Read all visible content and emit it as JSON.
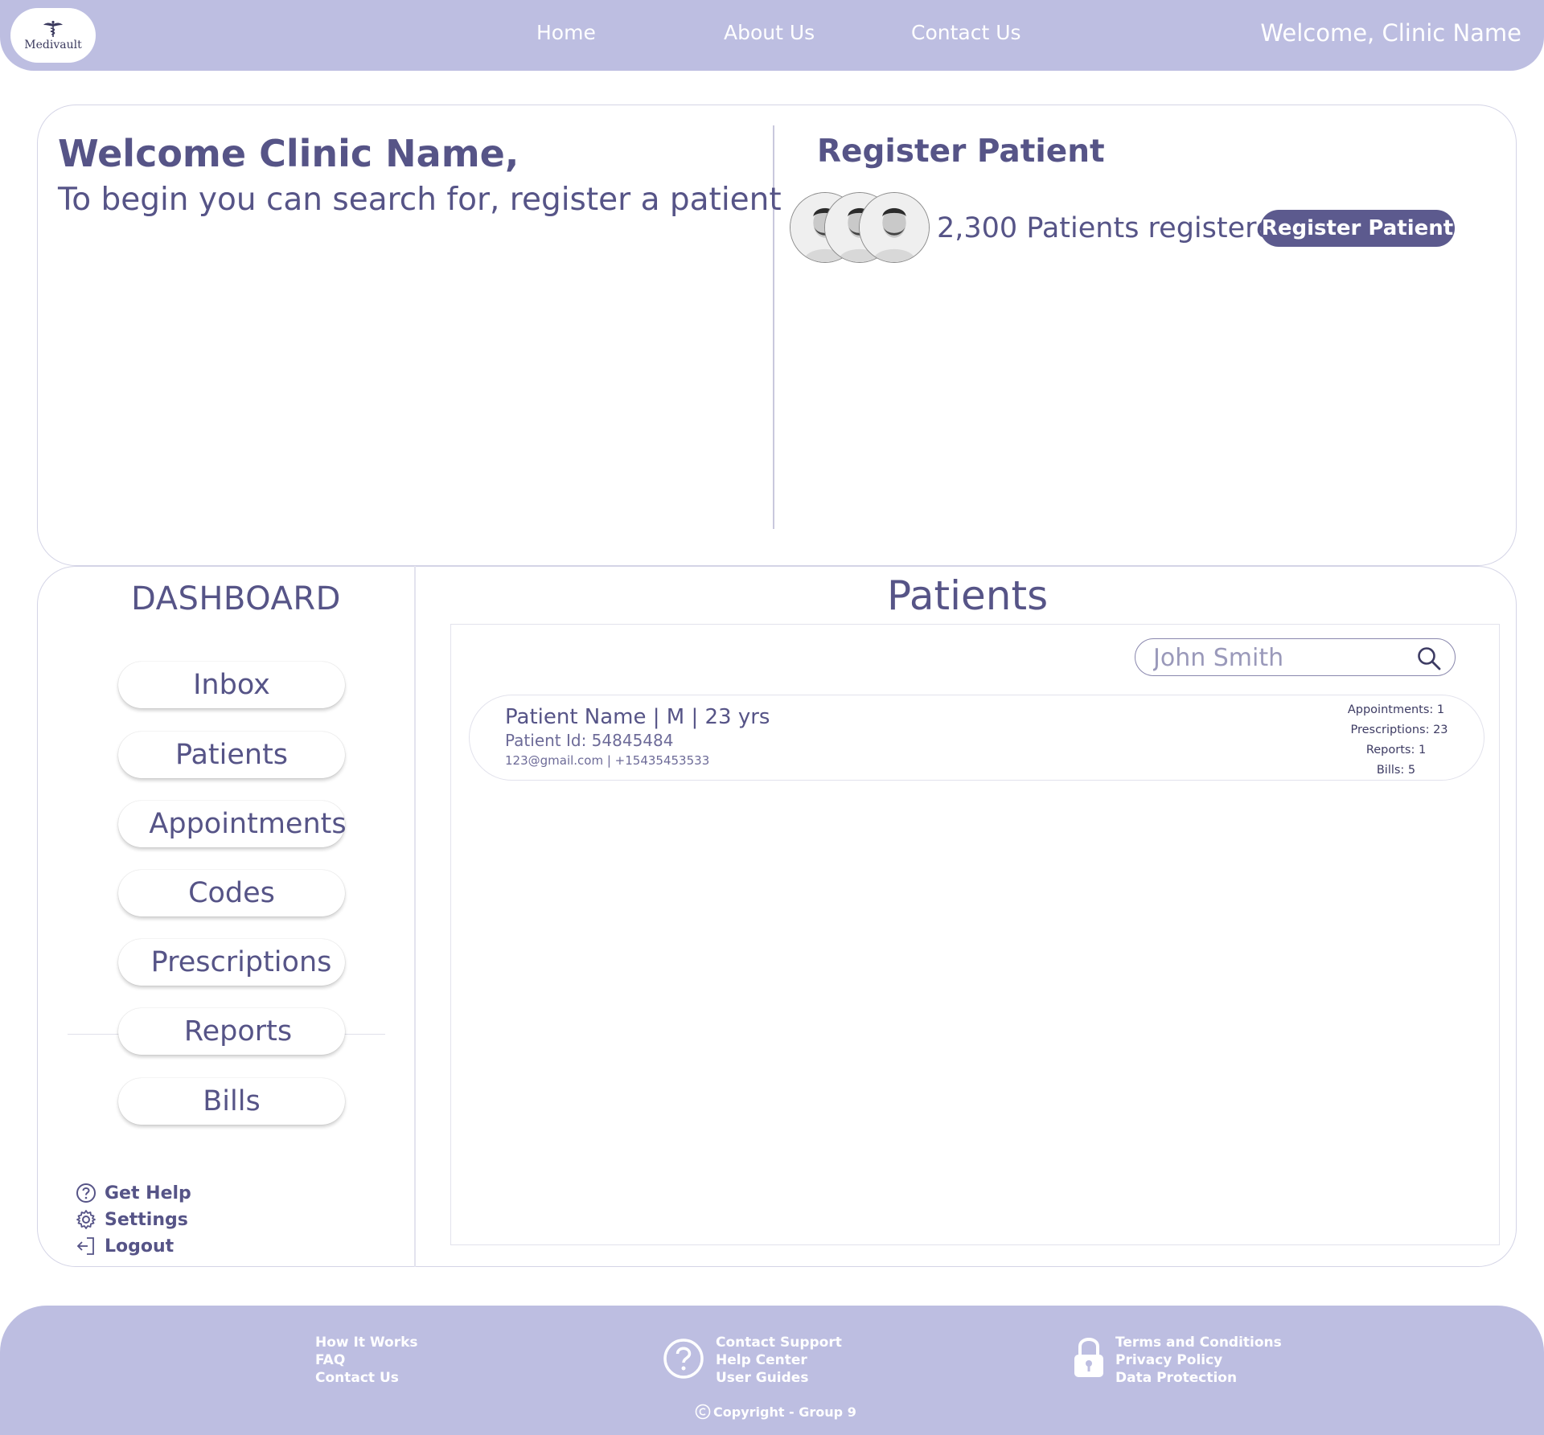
{
  "header": {
    "logo_text": "Medivault",
    "nav": {
      "home": "Home",
      "about": "About Us",
      "contact": "Contact Us"
    },
    "welcome": "Welcome, Clinic Name"
  },
  "intro": {
    "title": "Welcome Clinic Name,",
    "subtitle": "To begin you can search for, register a patient"
  },
  "register": {
    "title": "Register Patient",
    "count_text": "2,300 Patients registered",
    "button": "Register Patient"
  },
  "dashboard": {
    "title": "DASHBOARD",
    "items": [
      "Inbox",
      "Patients",
      "Appointments",
      "Codes",
      "Prescriptions",
      "Reports",
      "Bills"
    ],
    "utility": [
      "Get Help",
      "Settings",
      "Logout"
    ]
  },
  "patients": {
    "title": "Patients",
    "search_placeholder": "John Smith",
    "rows": [
      {
        "name_line": "Patient Name | M | 23 yrs",
        "id_line": "Patient Id: 54845484",
        "contact_line": "123@gmail.com | +15435453533",
        "appointments": "Appointments: 1",
        "prescriptions": "Prescriptions: 23",
        "reports": "Reports: 1",
        "bills": "Bills: 5"
      }
    ]
  },
  "footer": {
    "col1": [
      "How It Works",
      "FAQ",
      "Contact Us"
    ],
    "col2": [
      "Contact Support",
      "Help Center",
      "User Guides"
    ],
    "col3": [
      "Terms and Conditions",
      "Privacy Policy",
      "Data Protection"
    ],
    "copyright": "Copyright - Group 9"
  },
  "colors": {
    "header_bg": "#bdbee1",
    "accent": "#565487",
    "button_bg": "#5c5a8e"
  }
}
